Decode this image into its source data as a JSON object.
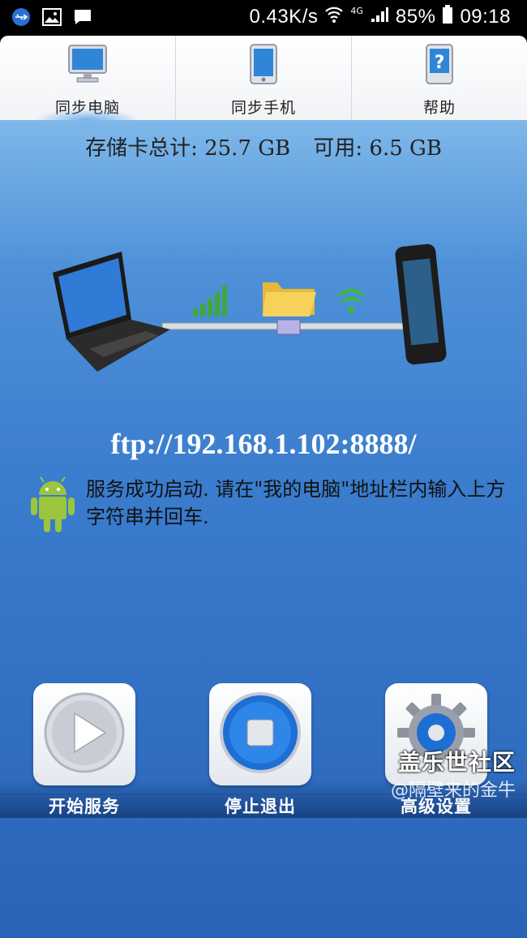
{
  "status_bar": {
    "speed": "0.43K/s",
    "network": "4G",
    "battery": "85%",
    "time": "09:18",
    "icons": [
      "usb-icon",
      "image-icon",
      "message-icon",
      "wifi-icon",
      "signal-icon",
      "battery-icon"
    ]
  },
  "tabs": [
    {
      "label": "同步电脑",
      "icon": "desktop-icon",
      "active": true
    },
    {
      "label": "同步手机",
      "icon": "phone-icon",
      "active": false
    },
    {
      "label": "帮助",
      "icon": "help-icon",
      "active": false
    }
  ],
  "storage": {
    "total": "存储卡总计: 25.7 GB",
    "available": "可用: 6.5 GB"
  },
  "ftp_address": "ftp://192.168.1.102:8888/",
  "message": "服务成功启动. 请在\"我的电脑\"地址栏内输入上方字符串并回车.",
  "buttons": {
    "start": "开始服务",
    "stop": "停止退出",
    "settings": "高级设置"
  },
  "watermark": {
    "line1": "盖乐世社区",
    "line2": "@隔壁来的金牛"
  },
  "colors": {
    "accent": "#3a7ccd",
    "text_light": "#ffffff"
  }
}
